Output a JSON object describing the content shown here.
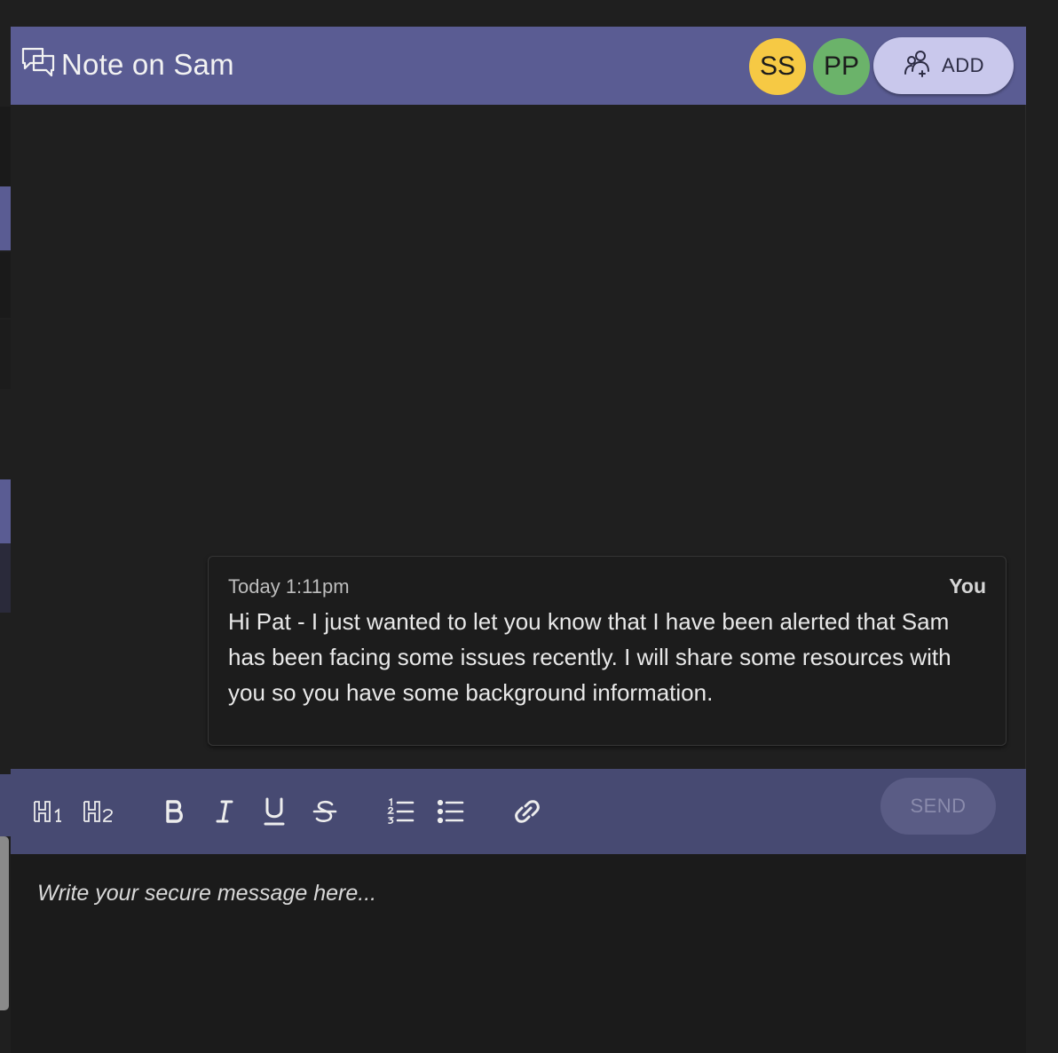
{
  "header": {
    "title": "Note on Sam",
    "icon": "chat-bubbles-icon",
    "participants": [
      {
        "initials": "SS",
        "color": "#f6c944"
      },
      {
        "initials": "PP",
        "color": "#6bb36a"
      }
    ],
    "add_label": "ADD",
    "add_icon": "add-user-icon",
    "color": "#5a5c93"
  },
  "messages": [
    {
      "time": "Today 1:11pm",
      "author": "You",
      "text": "Hi Pat - I just wanted to let you know that I have been alerted that Sam has been facing some issues recently. I will share some resources with you so you have some background information."
    }
  ],
  "toolbar": {
    "tools": [
      "heading-1-icon",
      "heading-2-icon",
      "bold-icon",
      "italic-icon",
      "underline-icon",
      "strikethrough-icon",
      "ordered-list-icon",
      "bullet-list-icon",
      "link-icon"
    ],
    "send_label": "SEND",
    "color": "#474a72"
  },
  "composer": {
    "placeholder": "Write your secure message here...",
    "value": ""
  }
}
